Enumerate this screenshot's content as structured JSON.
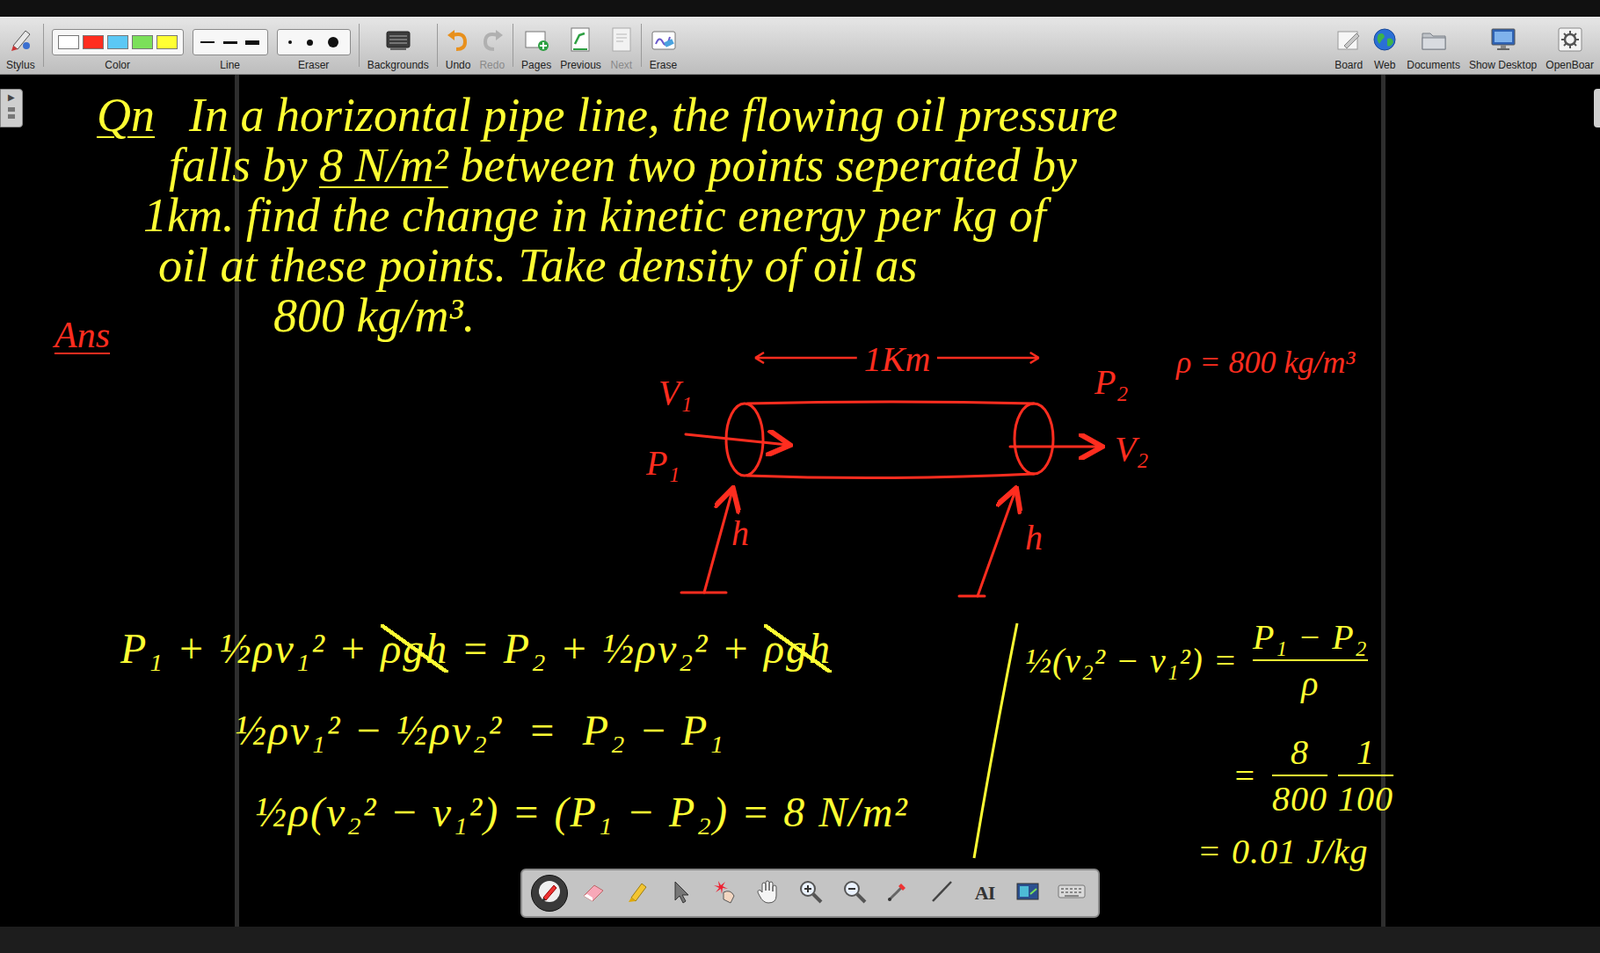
{
  "toolbar": {
    "items": [
      {
        "label": "Stylus",
        "kind": "stylus",
        "disabled": false
      },
      {
        "label": "Color",
        "kind": "palette",
        "disabled": false
      },
      {
        "label": "Line",
        "kind": "line",
        "disabled": false
      },
      {
        "label": "Eraser",
        "kind": "eraser",
        "disabled": false
      },
      {
        "label": "Backgrounds",
        "kind": "backgrounds",
        "disabled": false
      },
      {
        "label": "Undo",
        "kind": "undo",
        "disabled": false
      },
      {
        "label": "Redo",
        "kind": "redo",
        "disabled": true
      },
      {
        "label": "Pages",
        "kind": "pages",
        "disabled": false
      },
      {
        "label": "Previous",
        "kind": "previous",
        "disabled": false
      },
      {
        "label": "Next",
        "kind": "next",
        "disabled": true
      },
      {
        "label": "Erase",
        "kind": "erase",
        "disabled": false
      }
    ],
    "right_items": [
      {
        "label": "Board",
        "kind": "board"
      },
      {
        "label": "Web",
        "kind": "web"
      },
      {
        "label": "Documents",
        "kind": "documents"
      },
      {
        "label": "Show Desktop",
        "kind": "desktop"
      },
      {
        "label": "OpenBoar",
        "kind": "openboard"
      }
    ],
    "palette": [
      {
        "color": "#ffffff"
      },
      {
        "color": "#ff2d1f"
      },
      {
        "color": "#5bc8f5"
      },
      {
        "color": "#7be05a"
      },
      {
        "color": "#ffff33"
      }
    ]
  },
  "board": {
    "panel_toggle": {
      "glyph": "▶"
    },
    "question": {
      "label": "Qn",
      "lines": [
        [
          {
            "text": "In a horizontal pipe line, the flowing oil pressure",
            "underlined": false
          }
        ],
        [
          {
            "text": "falls by ",
            "underlined": false
          },
          {
            "text": "8 N/m²",
            "underlined": true
          },
          {
            "text": " between two points seperated by",
            "underlined": false
          }
        ],
        [
          {
            "text": "1km. find the change in kinetic energy per kg of",
            "underlined": false
          }
        ],
        [
          {
            "text": "oil at these points. Take density of oil as",
            "underlined": false
          }
        ],
        [
          {
            "text": "800 kg/m³.",
            "underlined": false
          }
        ]
      ]
    },
    "answer_label": "Ans",
    "diagram": {
      "length": "1Km",
      "v1": "V₁",
      "p1": "P₁",
      "v2": "V₂",
      "p2": "P₂",
      "density": "ρ = 800 kg/m³",
      "h_left": "h",
      "h_right": "h"
    },
    "equations": [
      {
        "segments": [
          {
            "kind": "text",
            "text": "P₁ + ½ρv₁² + ",
            "struck": false
          },
          {
            "kind": "text",
            "text": "ρgh",
            "struck": true
          },
          {
            "kind": "text",
            "text": " = P₂ + ½ρv₂² + ",
            "struck": false
          },
          {
            "kind": "text",
            "text": "ρgh",
            "struck": true
          }
        ]
      },
      {
        "segments": [
          {
            "kind": "text",
            "text": "½ρv₁² − ½ρv₂²  =  P₂ − P₁",
            "struck": false
          }
        ]
      },
      {
        "segments": [
          {
            "kind": "text",
            "text": "½ρ(v₂² − v₁²) = (P₁ − P₂) = 8 N/m²",
            "struck": false
          }
        ]
      }
    ],
    "working": [
      {
        "segments": [
          {
            "kind": "text",
            "text": "½(v₂² − v₁²) = ",
            "struck": false
          },
          {
            "kind": "fraction",
            "num": "P₁ − P₂",
            "den": "ρ"
          }
        ]
      },
      {
        "segments": [
          {
            "kind": "text",
            "text": "= ",
            "struck": false
          },
          {
            "kind": "fraction",
            "num": "8",
            "den": "800"
          },
          {
            "kind": "fraction",
            "num": "1",
            "den": "100"
          }
        ]
      },
      {
        "segments": [
          {
            "kind": "text",
            "text": "= 0.01 J/kg",
            "struck": false
          }
        ]
      }
    ]
  },
  "float_toolbar": {
    "tools": [
      {
        "kind": "pen",
        "selected": true
      },
      {
        "kind": "eraser",
        "selected": false
      },
      {
        "kind": "marker",
        "selected": false
      },
      {
        "kind": "pointer",
        "selected": false
      },
      {
        "kind": "laser",
        "selected": false
      },
      {
        "kind": "hand",
        "selected": false
      },
      {
        "kind": "zoom-in",
        "selected": false
      },
      {
        "kind": "zoom-out",
        "selected": false
      },
      {
        "kind": "picker",
        "selected": false
      },
      {
        "kind": "line",
        "selected": false
      },
      {
        "kind": "text",
        "selected": false,
        "glyph": "AI"
      },
      {
        "kind": "capture",
        "selected": false
      },
      {
        "kind": "keyboard",
        "selected": false
      }
    ]
  }
}
